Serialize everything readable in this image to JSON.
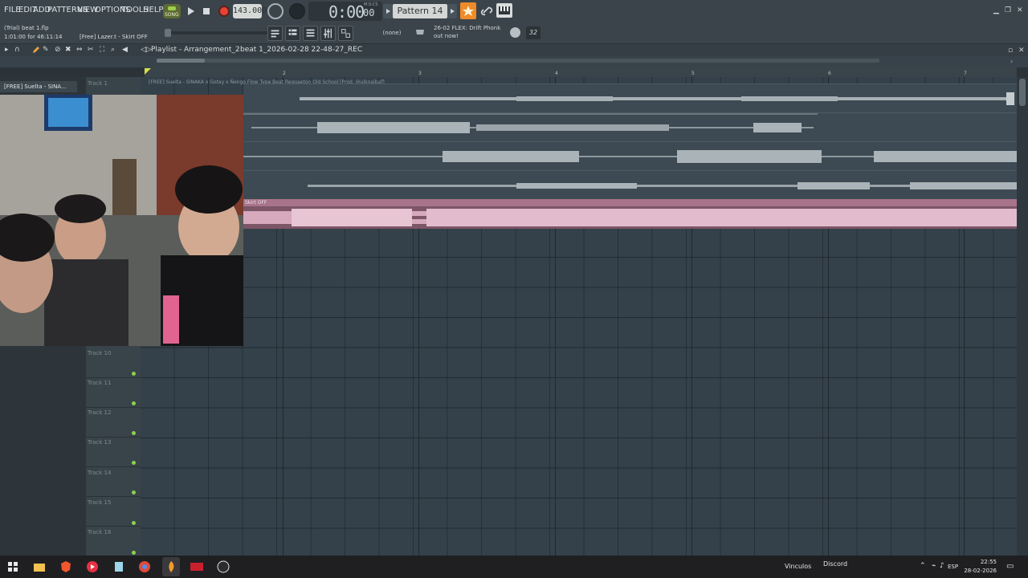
{
  "menu": [
    "FILE",
    "EDIT",
    "ADD",
    "PATTERNS",
    "VIEW",
    "OPTIONS",
    "TOOLS",
    "HELP"
  ],
  "transport": {
    "song_mode": "SONG",
    "tempo": "143.000",
    "time_main": "0:00",
    "time_sub": "00",
    "time_unit": "M:S:CS"
  },
  "pattern": {
    "name": "Pattern 14"
  },
  "hint": {
    "file_title": "(Trial) beat 1.flp",
    "time_info": "1:01:00 for 46:11:14",
    "sample_name": "[Free] Lazer.t - Skirt OFF",
    "none_select": "(none)",
    "news_line1": "26-02  FLEX: Drift Phonk",
    "news_line2": "out now!",
    "bits": "32"
  },
  "playlist": {
    "title": "Playlist - Arrangement_2",
    "breadcrumb": "beat 1_2026-02-28 22-48-27_REC",
    "bar_numbers": [
      "2",
      "3",
      "4",
      "5",
      "6",
      "7"
    ],
    "top_clip_title": "[FREE] Suelta - SINAKA x Gotay x Ñengo Flow Type Beat Reggaeton Old School [Prod. @ulknaibaf]",
    "pink_clip_title": "Skirt OFF",
    "browser_item": "[FREE] Suelta - SINA...",
    "tracks": [
      {
        "label": "Track 1"
      },
      {
        "label": "Track 10"
      },
      {
        "label": "Track 11"
      },
      {
        "label": "Track 12"
      },
      {
        "label": "Track 13"
      },
      {
        "label": "Track 14"
      },
      {
        "label": "Track 15"
      },
      {
        "label": "Track 16"
      }
    ]
  },
  "taskbar": {
    "vinculos": "Vinculos",
    "discord": "Discord",
    "lang": "ESP",
    "time": "22:55",
    "date": "28-02-2026"
  },
  "colors": {
    "accent": "#f08b2a",
    "clip_pink": "#a7748b",
    "led": "#8bd14c"
  }
}
